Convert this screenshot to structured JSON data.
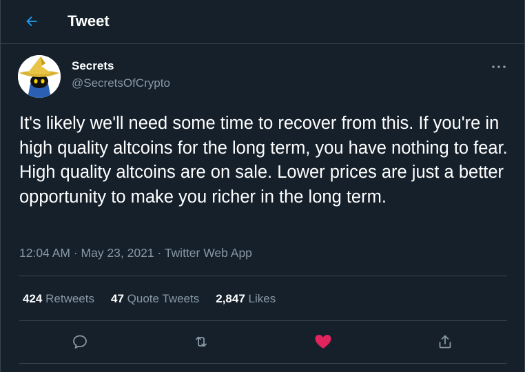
{
  "header": {
    "title": "Tweet",
    "back_icon": "arrow-left-icon"
  },
  "author": {
    "name": "Secrets",
    "handle": "@SecretsOfCrypto",
    "avatar_icon": "black-mage-avatar"
  },
  "tweet": {
    "text": "It's likely we'll need some time to recover from this. If you're in high quality altcoins for the long term, you have nothing to fear. High quality altcoins are on sale. Lower prices are just a better opportunity to make you richer in the long term."
  },
  "meta": {
    "time": "12:04 AM",
    "sep1": " · ",
    "date": "May 23, 2021",
    "sep2": " · ",
    "source": "Twitter Web App"
  },
  "stats": {
    "retweets": {
      "count": "424",
      "label": "Retweets"
    },
    "quotes": {
      "count": "47",
      "label": "Quote Tweets"
    },
    "likes": {
      "count": "2,847",
      "label": "Likes"
    }
  },
  "actions": {
    "reply_icon": "reply-icon",
    "retweet_icon": "retweet-icon",
    "like_icon": "heart-icon",
    "share_icon": "share-icon",
    "like_color": "#e0245e",
    "icon_color": "#8899a6",
    "accent": "#1da1f2"
  }
}
